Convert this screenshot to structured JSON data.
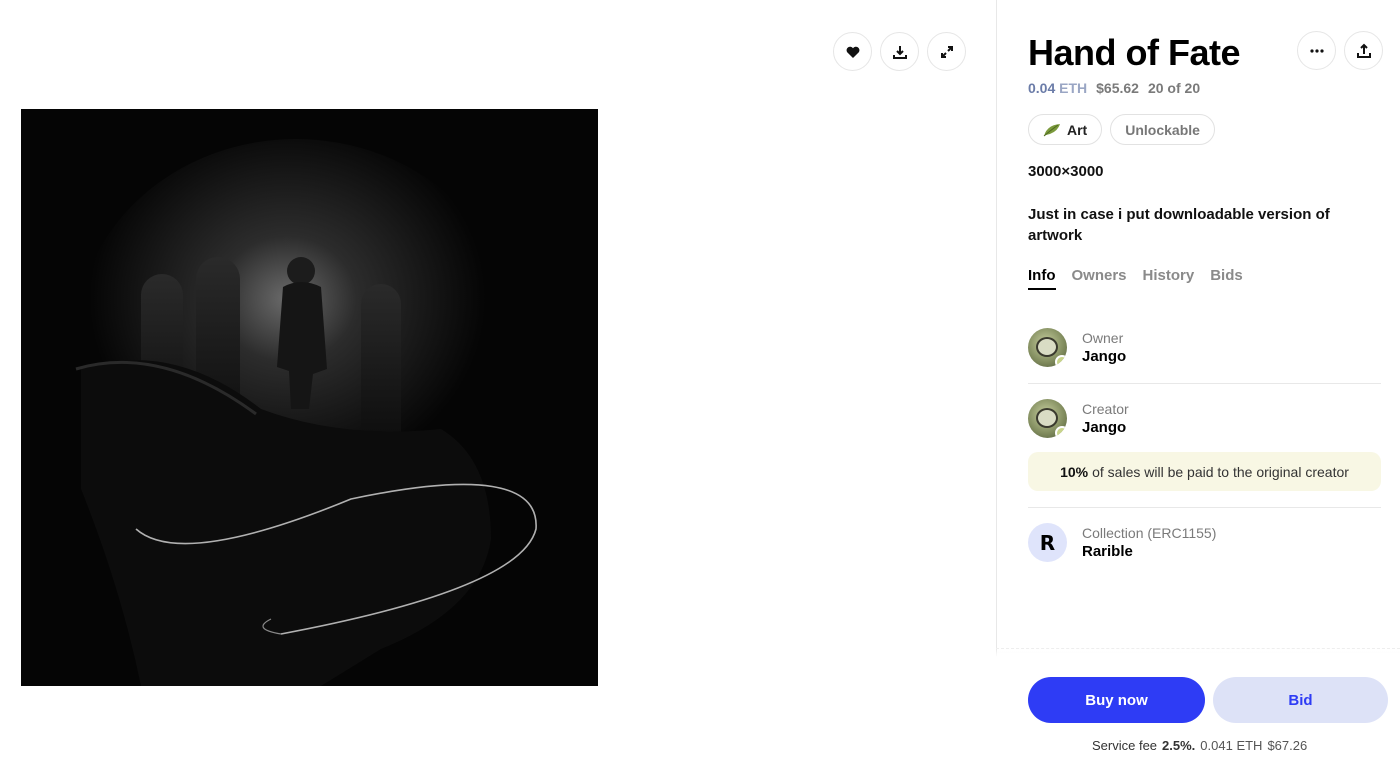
{
  "preview": {
    "actions": [
      {
        "icon": "heart-icon"
      },
      {
        "icon": "download-icon"
      },
      {
        "icon": "expand-icon"
      }
    ]
  },
  "item": {
    "title": "Hand of Fate",
    "price_eth": "0.04",
    "price_unit": "ETH",
    "price_usd": "$65.62",
    "edition": "20 of 20",
    "tags": [
      {
        "label": "Art",
        "icon": "leaf-icon"
      },
      {
        "label": "Unlockable"
      }
    ],
    "dimensions": "3000×3000",
    "description": "Just in case i put downloadable version of artwork"
  },
  "tabs": [
    {
      "label": "Info",
      "active": true
    },
    {
      "label": "Owners",
      "active": false
    },
    {
      "label": "History",
      "active": false
    },
    {
      "label": "Bids",
      "active": false
    }
  ],
  "owner": {
    "role": "Owner",
    "name": "Jango"
  },
  "creator": {
    "role": "Creator",
    "name": "Jango"
  },
  "royalty": {
    "percent": "10%",
    "text": "of sales will be paid to the original creator"
  },
  "collection": {
    "role": "Collection (ERC1155)",
    "name": "Rarible",
    "logo_letter": "R"
  },
  "actions": {
    "buy_label": "Buy now",
    "bid_label": "Bid"
  },
  "fee": {
    "label": "Service fee",
    "percent": "2.5%.",
    "eth": "0.041 ETH",
    "usd": "$67.26"
  },
  "colors": {
    "accent": "#2e3cf5",
    "bid_bg": "#dde2f7",
    "royalty_bg": "#f8f7e4"
  }
}
